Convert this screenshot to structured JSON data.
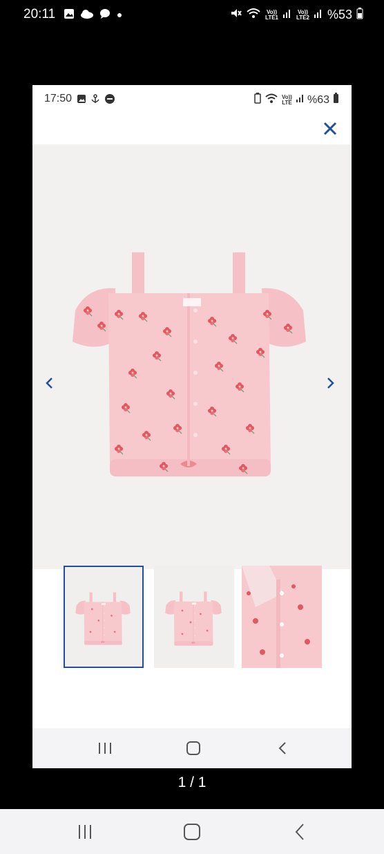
{
  "outer_status": {
    "time": "20:11",
    "battery": "%53",
    "lte1": "LTE1",
    "lte2": "LTE2",
    "volte": "Vo))"
  },
  "inner_status": {
    "time": "17:50",
    "battery": "%63",
    "lte": "LTE",
    "volte": "Vo))"
  },
  "viewer": {
    "counter": "1 / 1",
    "active_thumbnail": 1,
    "thumbnail_count": 3
  },
  "colors": {
    "accent": "#1f4fa0",
    "shirt_pink": "#f7c9cd",
    "flower": "#e3575f",
    "leaf": "#7fa37a"
  }
}
